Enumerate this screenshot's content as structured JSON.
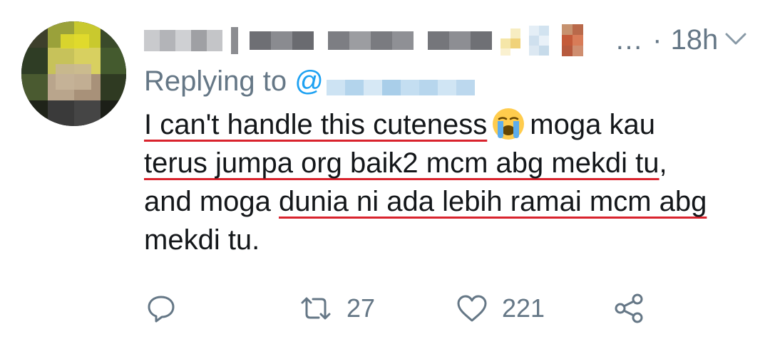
{
  "tweet": {
    "time_separator": "… ·",
    "timestamp": "18h",
    "replying_prefix": "Replying to",
    "handle_prefix": "@",
    "body_lines": [
      {
        "segments": [
          {
            "text": "I can't handle this cuteness",
            "underline": true
          },
          {
            "emoji": "loudly-crying-face"
          },
          {
            "text": "moga kau",
            "underline": false
          }
        ]
      },
      {
        "segments": [
          {
            "text": "terus jumpa org baik2 mcm abg mekdi tu",
            "underline": true
          },
          {
            "text": ",",
            "underline": false
          }
        ]
      },
      {
        "segments": [
          {
            "text": "and moga ",
            "underline": false
          },
          {
            "text": "dunia ni ada lebih ramai mcm abg",
            "underline": true
          }
        ]
      },
      {
        "segments": [
          {
            "text": "mekdi tu.",
            "underline": false
          }
        ]
      }
    ],
    "line1": {
      "a": "I can't handle this cuteness",
      "b": "moga kau"
    },
    "line2": {
      "a": "terus jumpa org baik2 mcm abg mekdi tu",
      "b": ","
    },
    "line3": {
      "a": "and moga ",
      "b": "dunia ni ada lebih ramai mcm abg"
    },
    "line4": {
      "a": "mekdi tu."
    }
  },
  "actions": {
    "reply_icon": "reply-icon",
    "retweet_icon": "retweet-icon",
    "retweet_count": "27",
    "like_icon": "heart-icon",
    "like_count": "221",
    "share_icon": "share-icon"
  },
  "colors": {
    "secondary_text": "#657786",
    "link": "#1da1f2",
    "body_text": "#14171a",
    "annotation_underline": "#d9232d"
  }
}
